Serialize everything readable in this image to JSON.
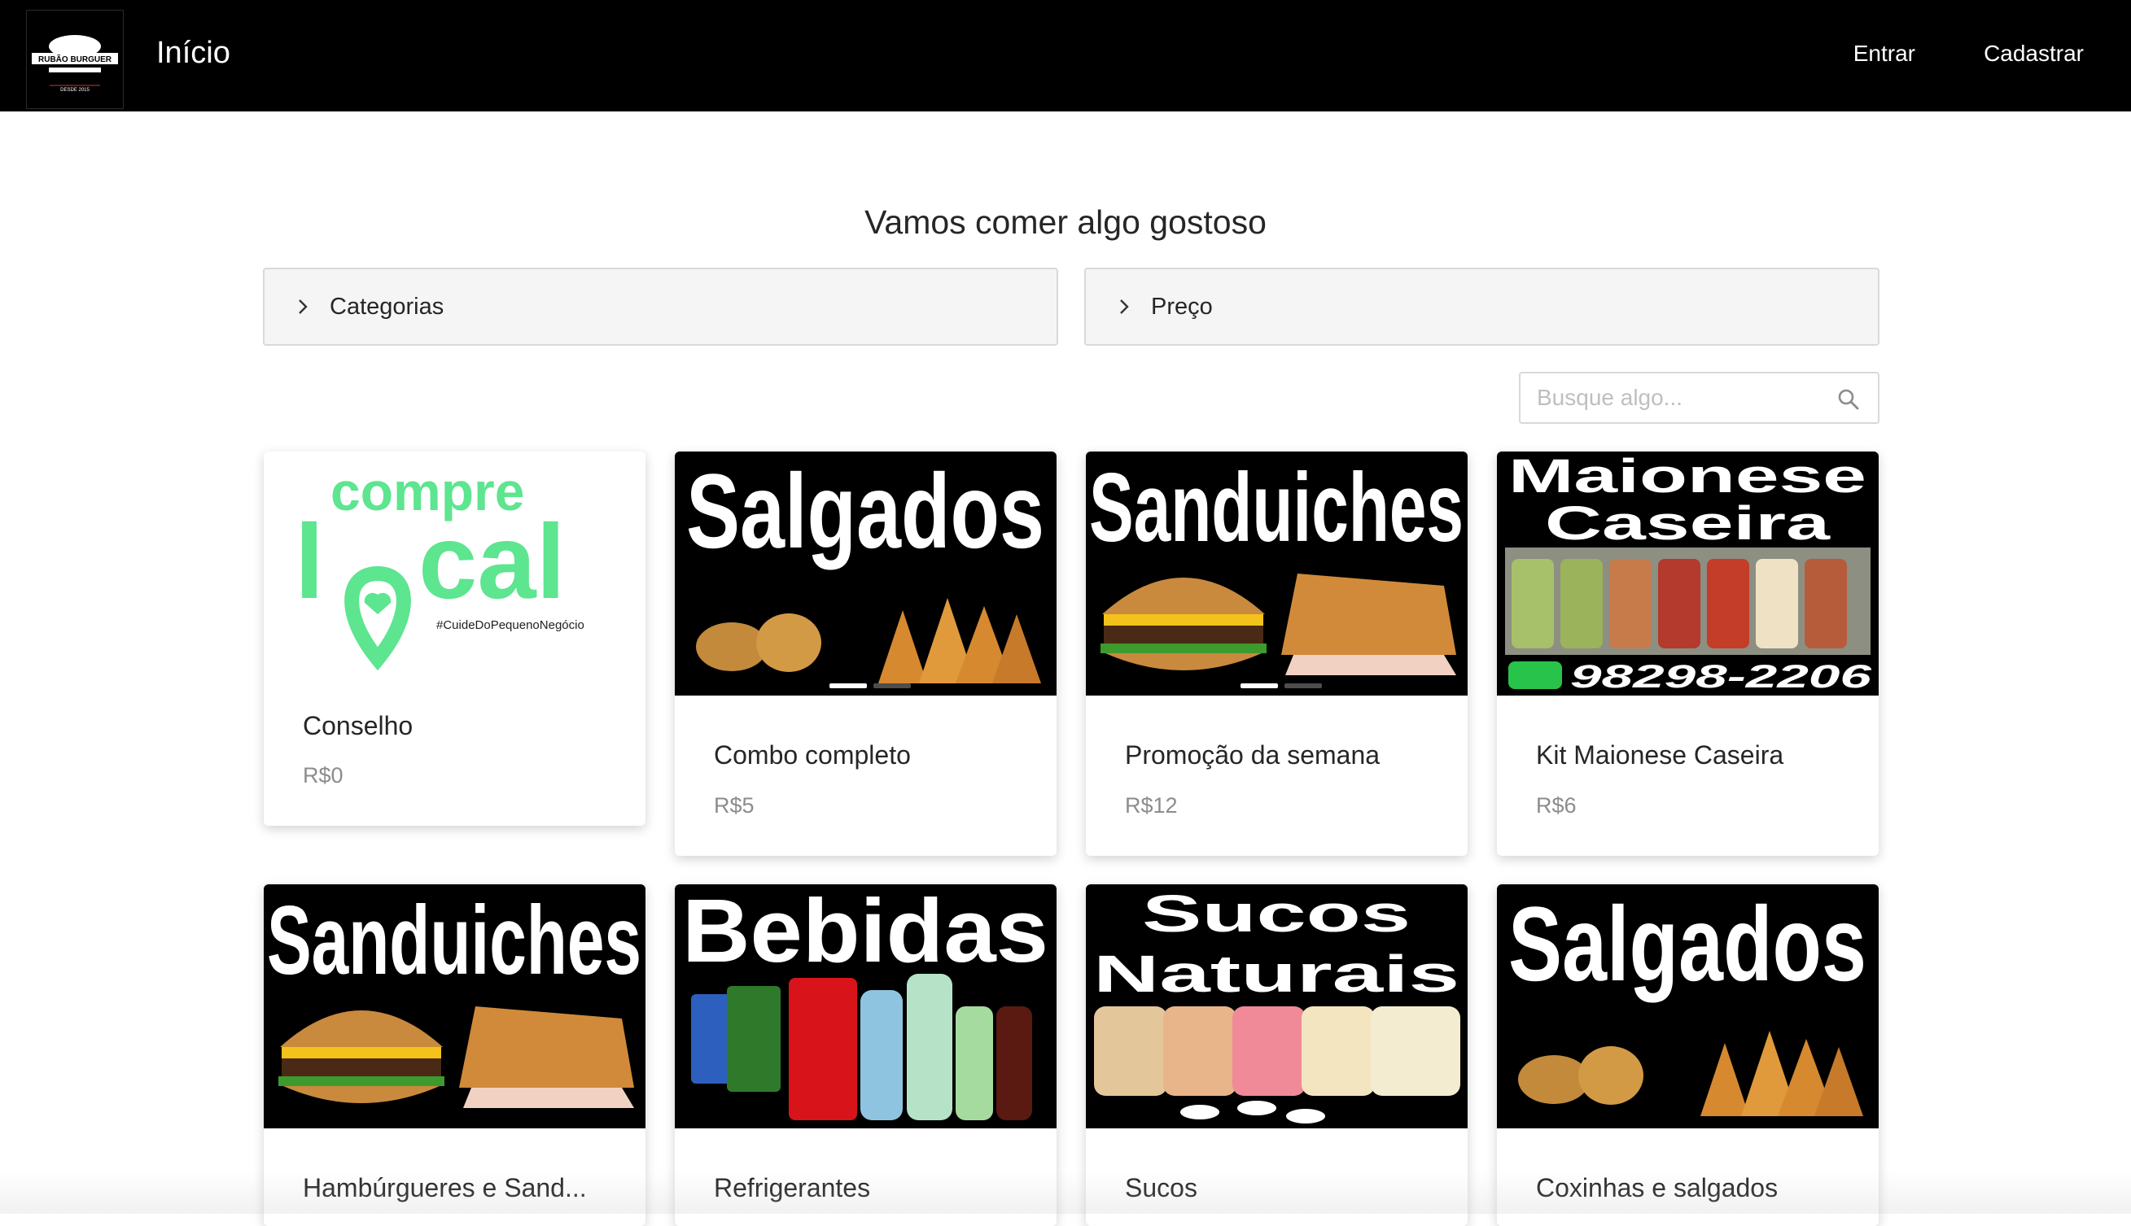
{
  "header": {
    "logo_text": "RUBÃO BURGUER",
    "logo_sub": "DESDE 2015",
    "home_label": "Início",
    "login_label": "Entrar",
    "signup_label": "Cadastrar"
  },
  "main": {
    "headline": "Vamos comer algo gostoso",
    "filters": [
      {
        "label": "Categorias"
      },
      {
        "label": "Preço"
      }
    ],
    "search": {
      "placeholder": "Busque algo..."
    }
  },
  "cards": [
    {
      "title": "Conselho",
      "price": "R$0",
      "image_text": [
        "compre",
        "l",
        "cal",
        "#CuideDoPequenoNegócio"
      ]
    },
    {
      "title": "Combo completo",
      "price": "R$5",
      "image_text": [
        "Salgados"
      ]
    },
    {
      "title": "Promoção da semana",
      "price": "R$12",
      "image_text": [
        "Sanduiches"
      ]
    },
    {
      "title": "Kit Maionese Caseira",
      "price": "R$6",
      "image_text": [
        "Maionese",
        "Caseira",
        "98298-2206"
      ]
    },
    {
      "title": "Hambúrgueres e Sand...",
      "image_text": [
        "Sanduiches"
      ]
    },
    {
      "title": "Refrigerantes",
      "image_text": [
        "Bebidas"
      ]
    },
    {
      "title": "Sucos",
      "image_text": [
        "Sucos",
        "Naturais"
      ]
    },
    {
      "title": "Coxinhas e salgados",
      "image_text": [
        "Salgados"
      ]
    }
  ],
  "colors": {
    "header_bg": "#000000",
    "accent_green": "#5de58f",
    "collapse_bg": "#f5f5f5",
    "price_gray": "#8c8c8c"
  },
  "icons": {
    "collapse": "chevron-right-icon",
    "search": "search-icon"
  }
}
